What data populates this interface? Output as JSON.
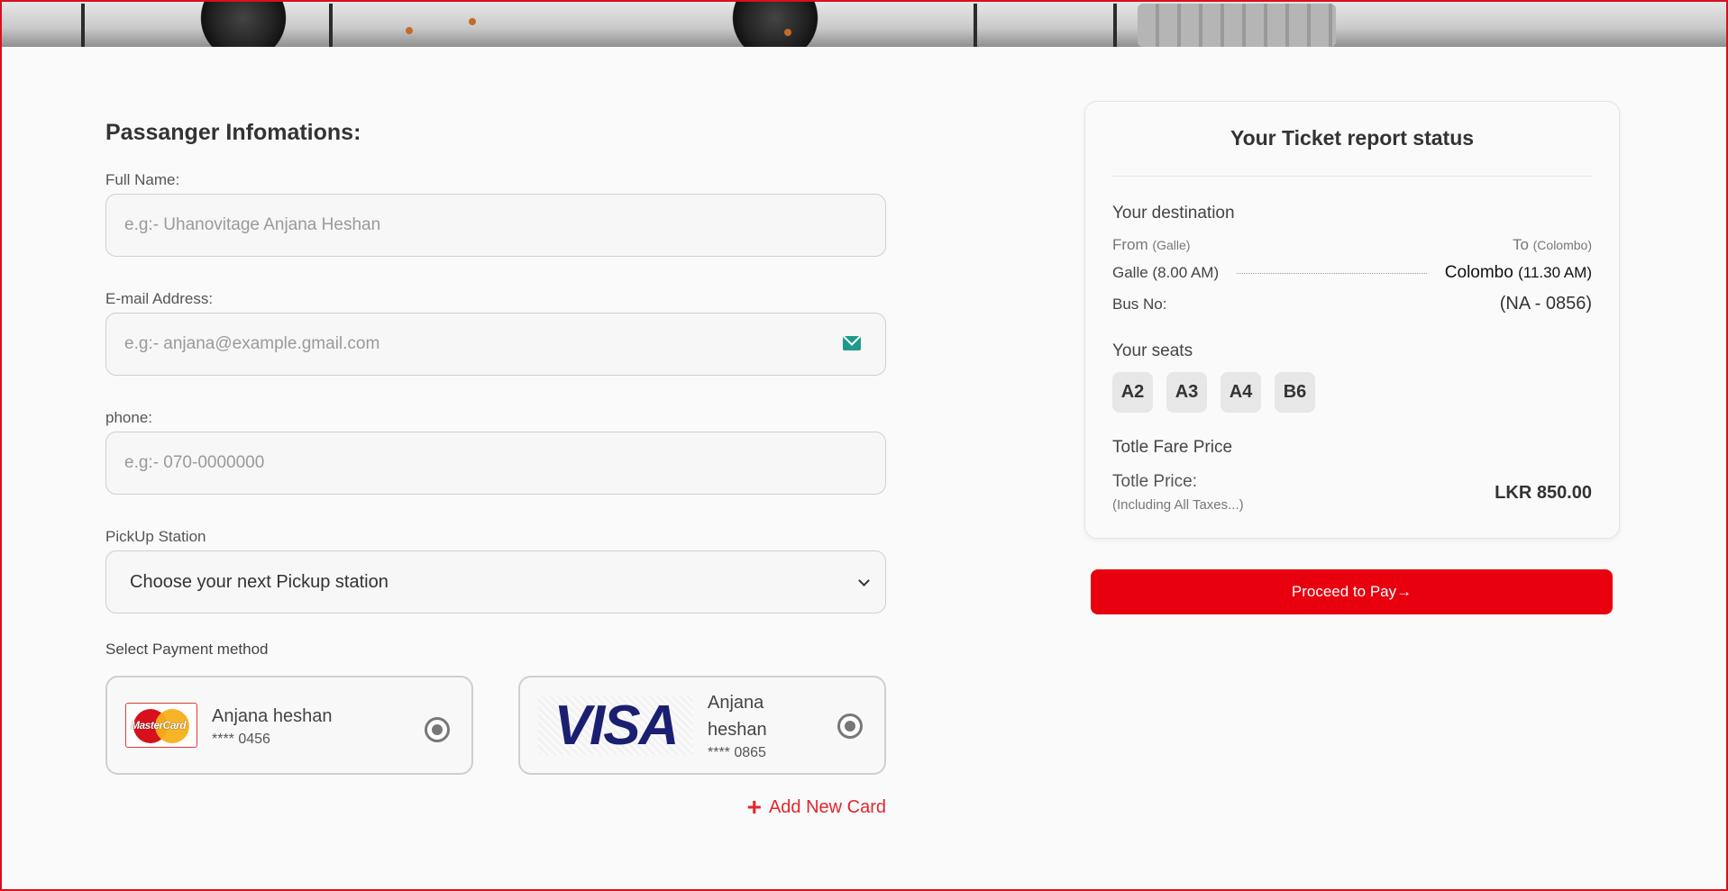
{
  "form": {
    "title": "Passanger Infomations:",
    "full_name": {
      "label": "Full Name:",
      "placeholder": "e.g:- Uhanovitage Anjana Heshan",
      "value": ""
    },
    "email": {
      "label": "E-mail Address:",
      "placeholder": "e.g:- anjana@example.gmail.com",
      "value": ""
    },
    "phone": {
      "label": "phone:",
      "placeholder": "e.g:- 070-0000000",
      "value": ""
    },
    "pickup": {
      "label": "PickUp Station",
      "selected": "Choose your next Pickup station"
    },
    "payment": {
      "label": "Select Payment method",
      "cards": [
        {
          "brand": "MasterCard",
          "name": "Anjana heshan",
          "number": "**** 0456"
        },
        {
          "brand": "VISA",
          "name": "Anjana heshan",
          "number": "**** 0865"
        }
      ],
      "add_card": "Add New Card"
    }
  },
  "summary": {
    "title": "Your Ticket report status",
    "destination": {
      "heading": "Your destination",
      "from_label": "From",
      "from_city": "(Galle)",
      "to_label": "To",
      "to_city": "(Colombo)",
      "departure": "Galle (8.00 AM)",
      "arrival_city": "Colombo",
      "arrival_time": "(11.30 AM)",
      "bus_label": "Bus No:",
      "bus_no": "(NA - 0856)"
    },
    "seats": {
      "heading": "Your seats",
      "list": [
        "A2",
        "A3",
        "A4",
        "B6"
      ]
    },
    "fare": {
      "heading": "Totle Fare Price",
      "label": "Totle Price:",
      "sub": "(Including All Taxes...)",
      "value": "LKR 850.00"
    }
  },
  "actions": {
    "pay_label": "Proceed to Pay→"
  },
  "colors": {
    "accent": "#e8000e",
    "frame": "#d8101c",
    "visa": "#1a1f71"
  }
}
